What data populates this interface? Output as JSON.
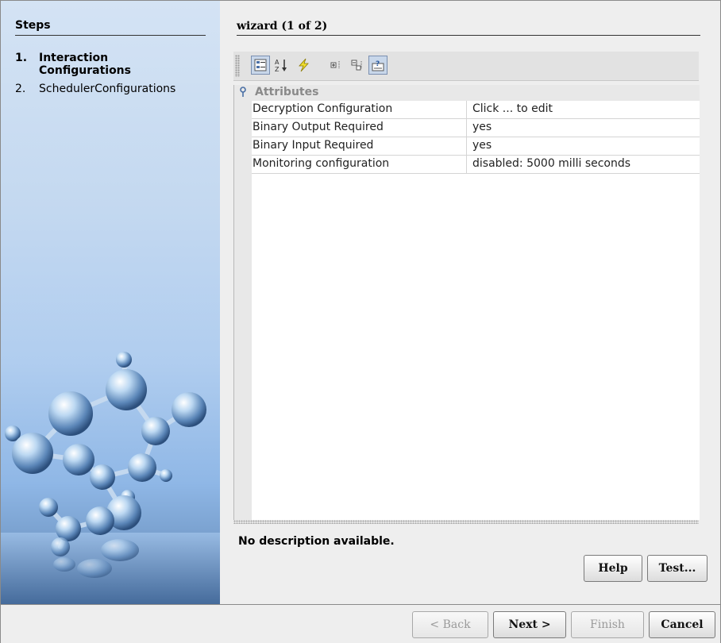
{
  "steps_panel": {
    "title": "Steps",
    "items": [
      {
        "num": "1.",
        "label": "Interaction Configurations",
        "active": true
      },
      {
        "num": "2.",
        "label": "SchedulerConfigurations",
        "active": false
      }
    ]
  },
  "wizard": {
    "title": "wizard (1 of 2)"
  },
  "toolbar": {
    "icons": [
      "categorized-view-icon",
      "sort-alphabetical-icon",
      "lightning-icon",
      "expand-all-icon",
      "collapse-all-icon",
      "description-toggle-icon"
    ]
  },
  "property_sheet": {
    "category": "Attributes",
    "rows": [
      {
        "name": "Decryption Configuration",
        "value": "Click ... to edit"
      },
      {
        "name": "Binary Output Required",
        "value": "yes"
      },
      {
        "name": "Binary Input Required",
        "value": "yes"
      },
      {
        "name": "Monitoring configuration",
        "value": "disabled: 5000 milli seconds"
      }
    ]
  },
  "description": "No description available.",
  "panel_buttons": {
    "help": "Help",
    "test": "Test..."
  },
  "nav_buttons": {
    "back": "< Back",
    "next": "Next >",
    "finish": "Finish",
    "cancel": "Cancel"
  }
}
